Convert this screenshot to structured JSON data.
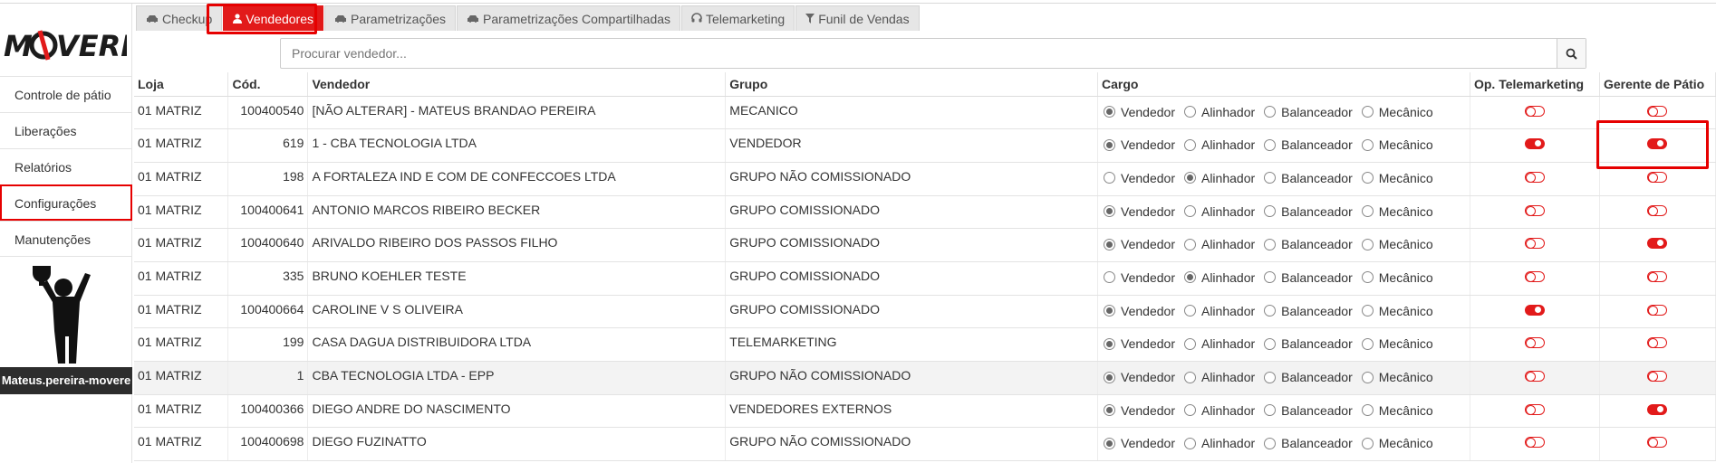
{
  "brand": {
    "logo_text": "MOVERE"
  },
  "sidebar": {
    "items": [
      {
        "label": "Controle de pátio"
      },
      {
        "label": "Liberações"
      },
      {
        "label": "Relatórios"
      },
      {
        "label": "Configurações"
      },
      {
        "label": "Manutenções"
      }
    ],
    "username": "Mateus.pereira-movere"
  },
  "tabs": [
    {
      "label": "Checkup",
      "icon": "car-icon"
    },
    {
      "label": "Vendedores",
      "icon": "user-icon",
      "active": true
    },
    {
      "label": "Parametrizações",
      "icon": "car-icon"
    },
    {
      "label": "Parametrizações Compartilhadas",
      "icon": "car-icon"
    },
    {
      "label": "Telemarketing",
      "icon": "headset-icon"
    },
    {
      "label": "Funil de Vendas",
      "icon": "filter-icon"
    }
  ],
  "search": {
    "placeholder": "Procurar vendedor..."
  },
  "table": {
    "headers": [
      "Loja",
      "Cód.",
      "Vendedor",
      "Grupo",
      "Cargo",
      "Op. Telemarketing",
      "Gerente de Pátio"
    ],
    "cargo_options": [
      "Vendedor",
      "Alinhador",
      "Balanceador",
      "Mecânico"
    ],
    "rows": [
      {
        "loja": "01 MATRIZ",
        "cod": "100400540",
        "vendedor": "[NÃO ALTERAR] - MATEUS BRANDAO PEREIRA",
        "grupo": "MECANICO",
        "cargo": "Vendedor",
        "telemarketing": false,
        "gerente": false
      },
      {
        "loja": "01 MATRIZ",
        "cod": "619",
        "vendedor": "1 - CBA TECNOLOGIA LTDA",
        "grupo": "VENDEDOR",
        "cargo": "Vendedor",
        "telemarketing": true,
        "gerente": true
      },
      {
        "loja": "01 MATRIZ",
        "cod": "198",
        "vendedor": "A FORTALEZA IND E COM DE CONFECCOES LTDA",
        "grupo": "GRUPO NÃO COMISSIONADO",
        "cargo": "Alinhador",
        "telemarketing": false,
        "gerente": false
      },
      {
        "loja": "01 MATRIZ",
        "cod": "100400641",
        "vendedor": "ANTONIO MARCOS RIBEIRO BECKER",
        "grupo": "GRUPO COMISSIONADO",
        "cargo": "Vendedor",
        "telemarketing": false,
        "gerente": false
      },
      {
        "loja": "01 MATRIZ",
        "cod": "100400640",
        "vendedor": "ARIVALDO RIBEIRO DOS PASSOS FILHO",
        "grupo": "GRUPO COMISSIONADO",
        "cargo": "Vendedor",
        "telemarketing": false,
        "gerente": true
      },
      {
        "loja": "01 MATRIZ",
        "cod": "335",
        "vendedor": "BRUNO KOEHLER TESTE",
        "grupo": "GRUPO COMISSIONADO",
        "cargo": "Alinhador",
        "telemarketing": false,
        "gerente": false
      },
      {
        "loja": "01 MATRIZ",
        "cod": "100400664",
        "vendedor": "CAROLINE V S OLIVEIRA",
        "grupo": "GRUPO COMISSIONADO",
        "cargo": "Vendedor",
        "telemarketing": true,
        "gerente": false
      },
      {
        "loja": "01 MATRIZ",
        "cod": "199",
        "vendedor": "CASA DAGUA DISTRIBUIDORA LTDA",
        "grupo": "TELEMARKETING",
        "cargo": "Vendedor",
        "telemarketing": false,
        "gerente": false
      },
      {
        "loja": "01 MATRIZ",
        "cod": "1",
        "vendedor": "CBA TECNOLOGIA LTDA - EPP",
        "grupo": "GRUPO NÃO COMISSIONADO",
        "cargo": "Vendedor",
        "telemarketing": false,
        "gerente": false
      },
      {
        "loja": "01 MATRIZ",
        "cod": "100400366",
        "vendedor": "DIEGO ANDRE DO NASCIMENTO",
        "grupo": "VENDEDORES EXTERNOS",
        "cargo": "Vendedor",
        "telemarketing": false,
        "gerente": true
      },
      {
        "loja": "01 MATRIZ",
        "cod": "100400698",
        "vendedor": "DIEGO FUZINATTO",
        "grupo": "GRUPO NÃO COMISSIONADO",
        "cargo": "Vendedor",
        "telemarketing": false,
        "gerente": false
      }
    ]
  },
  "colors": {
    "accent": "#e21a1a",
    "highlight": "#e60000"
  }
}
